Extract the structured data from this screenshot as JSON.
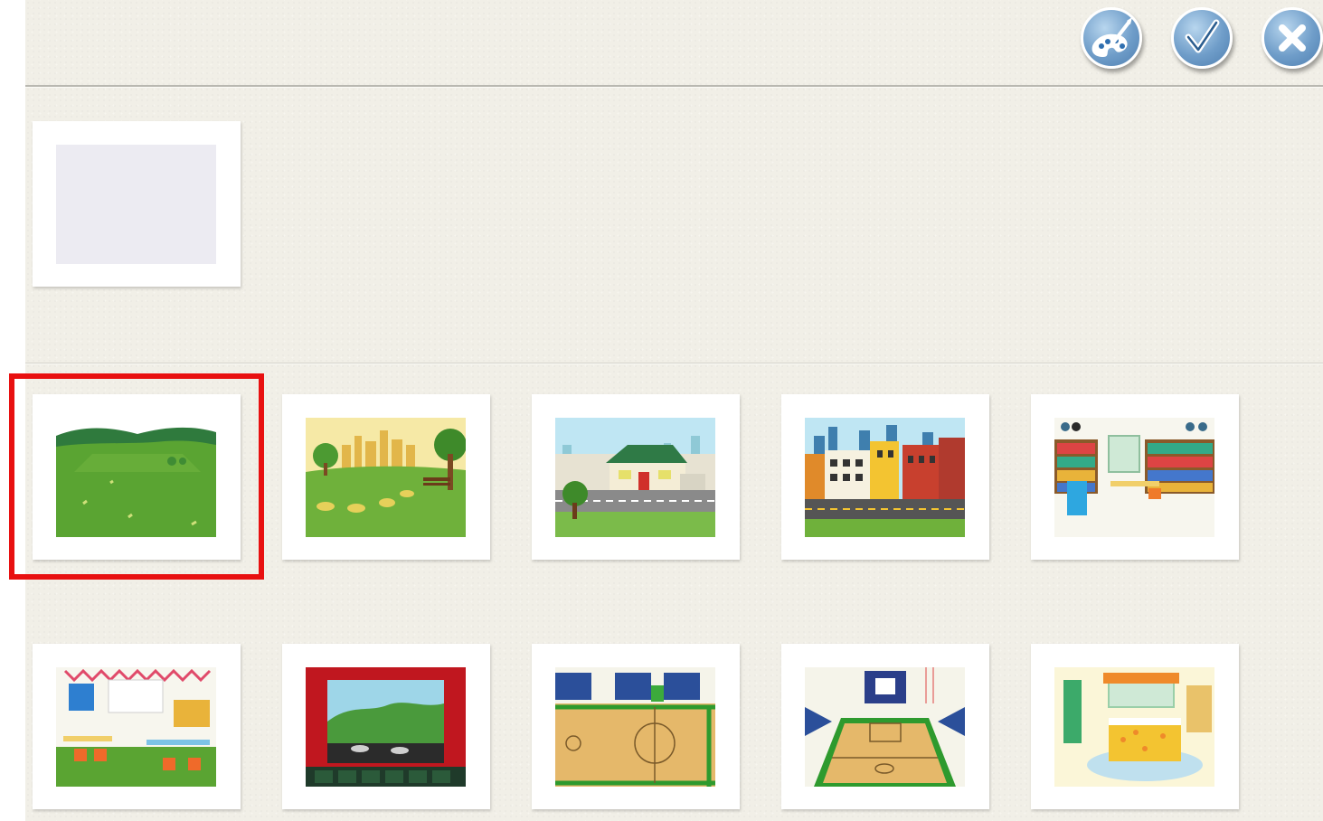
{
  "toolbar": {
    "buttons": [
      {
        "name": "paint-button",
        "icon": "paintbrush-icon"
      },
      {
        "name": "confirm-button",
        "icon": "checkmark-icon"
      },
      {
        "name": "close-button",
        "icon": "close-icon"
      }
    ],
    "button_color": "#6f9dc9"
  },
  "custom_background": {
    "icon": "blank-canvas"
  },
  "backgrounds": [
    {
      "name": "meadow",
      "selected": true
    },
    {
      "name": "city-park",
      "selected": false
    },
    {
      "name": "suburban-house",
      "selected": false
    },
    {
      "name": "city-street",
      "selected": false
    },
    {
      "name": "library",
      "selected": false
    },
    {
      "name": "classroom",
      "selected": false
    },
    {
      "name": "theater-stage",
      "selected": false
    },
    {
      "name": "gym-side-view",
      "selected": false
    },
    {
      "name": "gym-court",
      "selected": false
    },
    {
      "name": "bedroom",
      "selected": false
    }
  ],
  "selection_color": "#e81010"
}
